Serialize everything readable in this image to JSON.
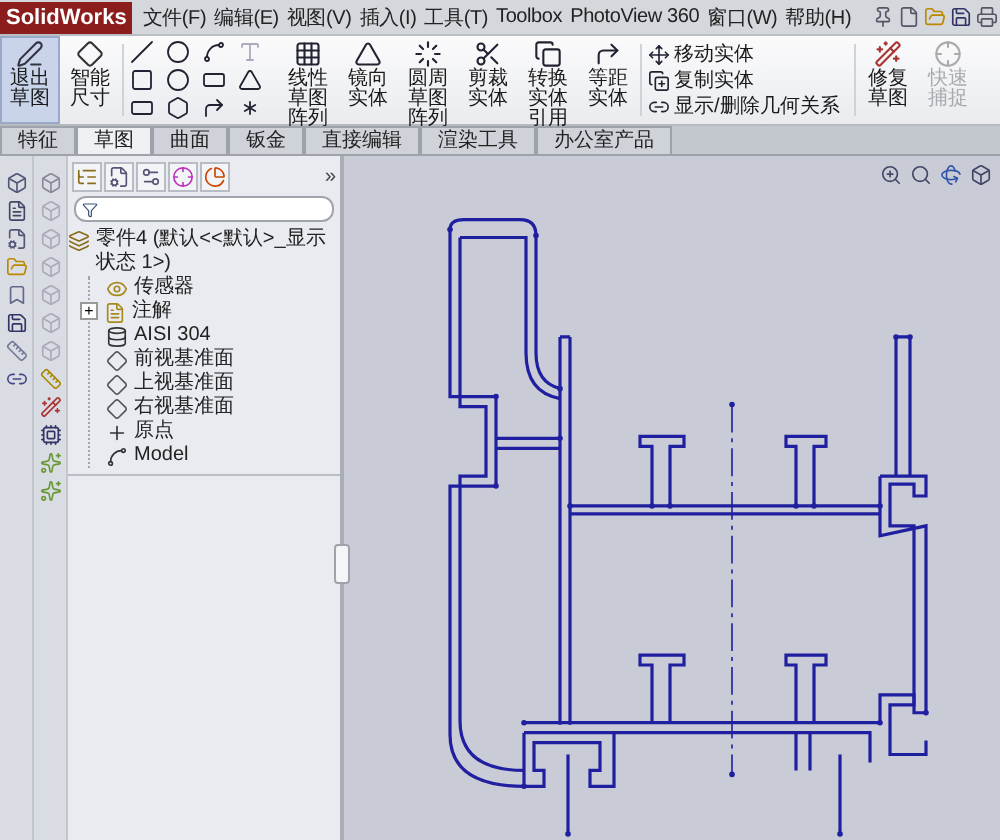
{
  "app": {
    "logo": "SolidWorks"
  },
  "menu": [
    "文件(F)",
    "编辑(E)",
    "视图(V)",
    "插入(I)",
    "工具(T)",
    "Toolbox",
    "PhotoView 360",
    "窗口(W)",
    "帮助(H)"
  ],
  "ribbon": [
    {
      "kind": "large",
      "label": "退出草图",
      "selected": true,
      "disabled": false
    },
    {
      "kind": "large",
      "label": "智能尺寸",
      "selected": false,
      "disabled": false
    },
    {
      "kind": "tools"
    },
    {
      "kind": "large",
      "label": "线性草图阵列",
      "selected": false,
      "disabled": false
    },
    {
      "kind": "large",
      "label": "镜向实体",
      "selected": false,
      "disabled": false
    },
    {
      "kind": "large",
      "label": "圆周草图阵列",
      "selected": false,
      "disabled": false
    },
    {
      "kind": "large",
      "label": "剪裁实体",
      "selected": false,
      "disabled": false
    },
    {
      "kind": "large",
      "label": "转换实体引用",
      "selected": false,
      "disabled": false
    },
    {
      "kind": "large",
      "label": "等距实体",
      "selected": false,
      "disabled": false
    },
    {
      "kind": "list",
      "items": [
        "移动实体",
        "复制实体",
        "显示/删除几何关系"
      ]
    },
    {
      "kind": "large",
      "label": "修复草图",
      "selected": false,
      "disabled": false
    },
    {
      "kind": "large",
      "label": "快速捕捉",
      "selected": false,
      "disabled": true
    }
  ],
  "command_tabs": [
    {
      "label": "特征",
      "selected": false
    },
    {
      "label": "草图",
      "selected": true
    },
    {
      "label": "曲面",
      "selected": false
    },
    {
      "label": "钣金",
      "selected": false
    },
    {
      "label": "直接编辑",
      "selected": false
    },
    {
      "label": "渲染工具",
      "selected": false
    },
    {
      "label": "办公室产品",
      "selected": false
    }
  ],
  "panel": {
    "overflow": "»",
    "tree": {
      "label": "零件4 (默认<<默认>_显示状态 1>)",
      "kind": "part",
      "children": [
        {
          "label": "传感器",
          "kind": "sensor"
        },
        {
          "label": "注解",
          "kind": "annotation",
          "toggle": "+"
        },
        {
          "label": "AISI 304",
          "kind": "material"
        },
        {
          "label": "前视基准面",
          "kind": "plane"
        },
        {
          "label": "上视基准面",
          "kind": "plane"
        },
        {
          "label": "右视基准面",
          "kind": "plane"
        },
        {
          "label": "原点",
          "kind": "origin"
        },
        {
          "label": "Model",
          "kind": "sketch"
        }
      ]
    }
  }
}
